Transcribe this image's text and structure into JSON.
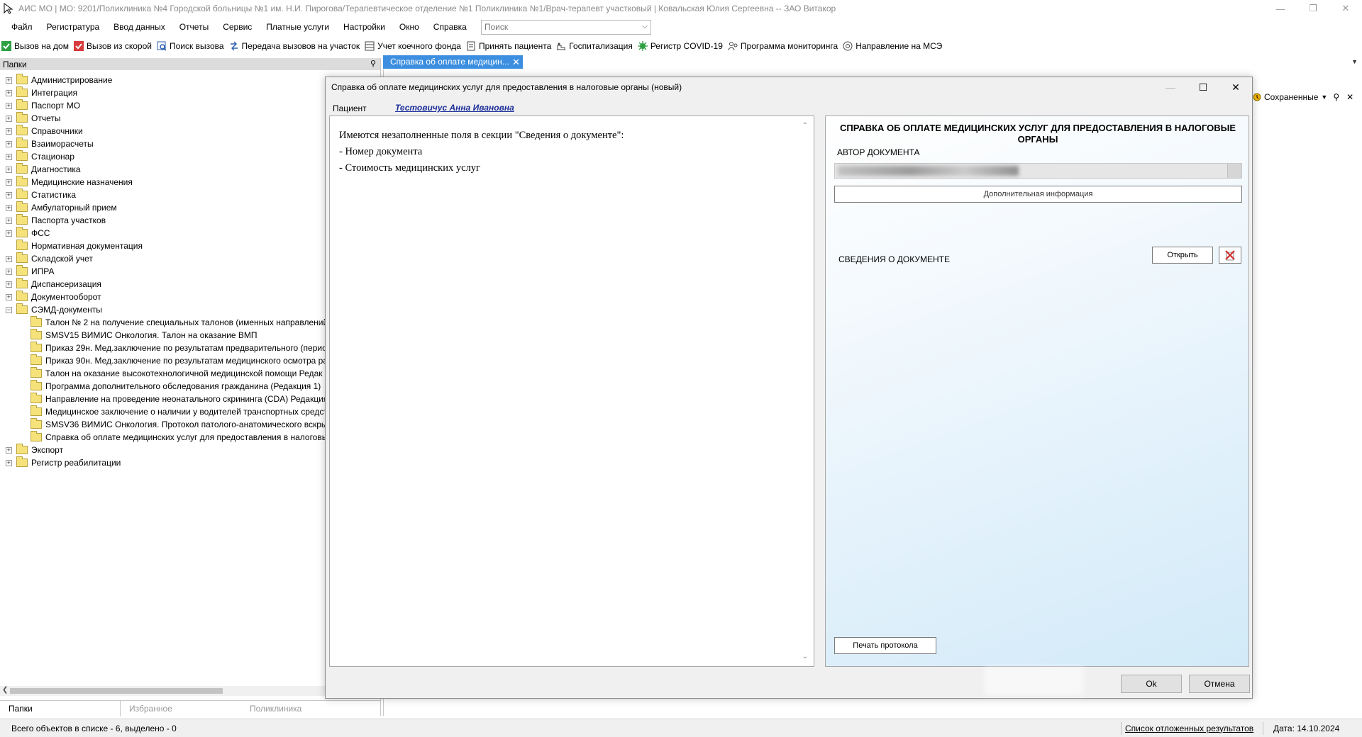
{
  "window": {
    "title": "АИС МО | МО: 9201/Поликлиника №4 Городской больницы №1 им. Н.И. Пирогова/Терапевтическое отделение №1 Поликлиника №1/Врач-терапевт участковый | Ковальская Юлия Сергеевна -- ЗАО Витакор"
  },
  "menu": [
    "Файл",
    "Регистратура",
    "Ввод данных",
    "Отчеты",
    "Сервис",
    "Платные услуги",
    "Настройки",
    "Окно",
    "Справка"
  ],
  "search": {
    "placeholder": "Поиск"
  },
  "toolbar": [
    {
      "label": "Вызов на дом",
      "icon": "green-check-icon",
      "color": "#2ea043"
    },
    {
      "label": "Вызов из скорой",
      "icon": "red-check-icon",
      "color": "#d83b3b"
    },
    {
      "label": "Поиск вызова",
      "icon": "search-call-icon",
      "color": "#2a5db0"
    },
    {
      "label": "Передача вызовов на участок",
      "icon": "transfer-icon",
      "color": "#2a5db0"
    },
    {
      "label": "Учет коечного фонда",
      "icon": "bed-icon",
      "color": "#444444"
    },
    {
      "label": "Принять пациента",
      "icon": "accept-patient-icon",
      "color": "#444444"
    },
    {
      "label": "Госпитализация",
      "icon": "hospitalization-icon",
      "color": "#444444"
    },
    {
      "label": "Регистр COVID-19",
      "icon": "covid-icon",
      "color": "#2ea043"
    },
    {
      "label": "Программа мониторинга",
      "icon": "monitoring-icon",
      "color": "#444444"
    },
    {
      "label": "Направление на МСЭ",
      "icon": "mse-icon",
      "color": "#444444"
    }
  ],
  "left_panel": {
    "header": "Папки",
    "tree": [
      {
        "label": "Администрирование",
        "expand": "+"
      },
      {
        "label": "Интеграция",
        "expand": "+"
      },
      {
        "label": "Паспорт МО",
        "expand": "+"
      },
      {
        "label": "Отчеты",
        "expand": "+"
      },
      {
        "label": "Справочники",
        "expand": "+"
      },
      {
        "label": "Взаиморасчеты",
        "expand": "+"
      },
      {
        "label": "Стационар",
        "expand": "+"
      },
      {
        "label": "Диагностика",
        "expand": "+"
      },
      {
        "label": "Медицинские назначения",
        "expand": "+"
      },
      {
        "label": "Статистика",
        "expand": "+"
      },
      {
        "label": "Амбулаторный прием",
        "expand": "+"
      },
      {
        "label": "Паспорта участков",
        "expand": "+"
      },
      {
        "label": "ФСС",
        "expand": "+"
      },
      {
        "label": "Нормативная документация",
        "expand": ""
      },
      {
        "label": "Складской учет",
        "expand": "+"
      },
      {
        "label": "ИПРА",
        "expand": "+"
      },
      {
        "label": "Диспансеризация",
        "expand": "+"
      },
      {
        "label": "Документооборот",
        "expand": "+"
      },
      {
        "label": "СЭМД-документы",
        "expand": "−"
      },
      {
        "label": "Талон № 2 на получение специальных талонов (именных направлений",
        "child": true
      },
      {
        "label": "SMSV15 ВИМИС Онкология. Талон на оказание ВМП",
        "child": true
      },
      {
        "label": "Приказ 29н. Мед.заключение по результатам предварительного (перио",
        "child": true
      },
      {
        "label": "Приказ 90н. Мед.заключение по результатам медицинского осмотра ра",
        "child": true
      },
      {
        "label": "Талон на оказание высокотехнологичной медицинской помощи Редак",
        "child": true
      },
      {
        "label": "Программа дополнительного обследования гражданина (Редакция 1)",
        "child": true
      },
      {
        "label": "Направление на проведение неонатального скрининга (CDA) Редакция",
        "child": true
      },
      {
        "label": "Медицинское заключение о наличии у водителей транспортных средст",
        "child": true
      },
      {
        "label": "SMSV36 ВИМИС Онкология. Протокол патолого-анатомического вскры",
        "child": true
      },
      {
        "label": "Справка об оплате медицинских услуг для предоставления в налоговы",
        "child": true
      },
      {
        "label": "Экспорт",
        "expand": "+"
      },
      {
        "label": "Регистр реабилитации",
        "expand": "+"
      }
    ],
    "tabs": [
      "Папки",
      "Избранное",
      "Поликлиника"
    ]
  },
  "doc_tab": {
    "label": "Справка об оплате медицин..."
  },
  "saved_menu": {
    "label": "Сохраненные"
  },
  "dialog": {
    "title": "Справка об оплате медицинских услуг для предоставления в налоговые органы (новый)",
    "patient_label": "Пациент",
    "patient_name": "Тестовичус Анна Ивановна",
    "messages": [
      "Имеются незаполненные поля в секции \"Сведения о документе\":",
      "- Номер документа",
      "- Стоимость медицинских услуг"
    ],
    "form": {
      "title": "СПРАВКА ОБ ОПЛАТЕ МЕДИЦИНСКИХ УСЛУГ ДЛЯ ПРЕДОСТАВЛЕНИЯ В НАЛОГОВЫЕ ОРГАНЫ",
      "author_label": "АВТОР ДОКУМЕНТА",
      "additional_info_button": "Дополнительная информация",
      "section_label": "СВЕДЕНИЯ О ДОКУМЕНТЕ",
      "open_button": "Открыть",
      "print_button": "Печать протокола"
    },
    "ok_button": "Ok",
    "cancel_button": "Отмена"
  },
  "status": {
    "objects": "Всего объектов в списке - 6, выделено - 0",
    "deferred_link": "Список отложенных результатов",
    "date": "Дата: 14.10.2024"
  },
  "colors": {
    "accent_tab": "#3c8fe0",
    "patient_link": "#1c2f9a",
    "delete_icon": "#d12b2b"
  }
}
